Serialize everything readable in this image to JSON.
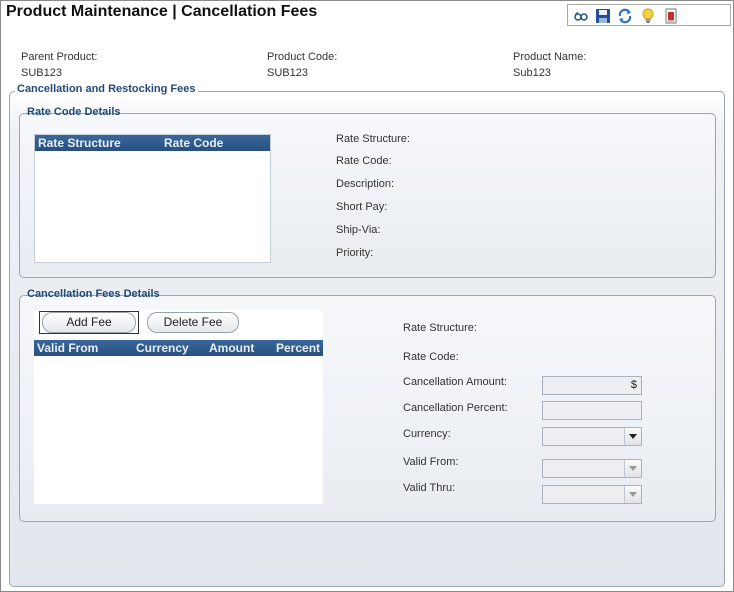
{
  "header": {
    "title": "Product Maintenance  |  Cancellation Fees",
    "toolbar_icons": [
      "find-icon",
      "save-icon",
      "refresh-icon",
      "lightbulb-icon",
      "report-icon"
    ]
  },
  "product": {
    "parent_label": "Parent Product:",
    "parent_value": "SUB123",
    "code_label": "Product Code:",
    "code_value": "SUB123",
    "name_label": "Product Name:",
    "name_value": "Sub123"
  },
  "cancellation_section": {
    "legend": "Cancellation and Restocking Fees",
    "rate_code_details": {
      "legend": "Rate Code Details",
      "columns": [
        "Rate Structure",
        "Rate Code"
      ],
      "rows": [],
      "labels": {
        "rate_structure": "Rate Structure:",
        "rate_code": "Rate Code:",
        "description": "Description:",
        "short_pay": "Short Pay:",
        "ship_via": "Ship-Via:",
        "priority": "Priority:"
      }
    },
    "fees_details": {
      "legend": "Cancellation Fees Details",
      "add_button": "Add Fee",
      "delete_button": "Delete Fee",
      "columns": [
        "Valid From",
        "Currency",
        "Amount",
        "Percent"
      ],
      "rows": [],
      "labels": {
        "rate_structure": "Rate Structure:",
        "rate_code": "Rate Code:",
        "amount": "Cancellation Amount:",
        "percent": "Cancellation Percent:",
        "currency": "Currency:",
        "valid_from": "Valid From:",
        "valid_thru": "Valid Thru:"
      },
      "amount_suffix": "$",
      "amount_value": "",
      "percent_value": "",
      "currency_value": "",
      "valid_from_value": "",
      "valid_thru_value": ""
    }
  }
}
